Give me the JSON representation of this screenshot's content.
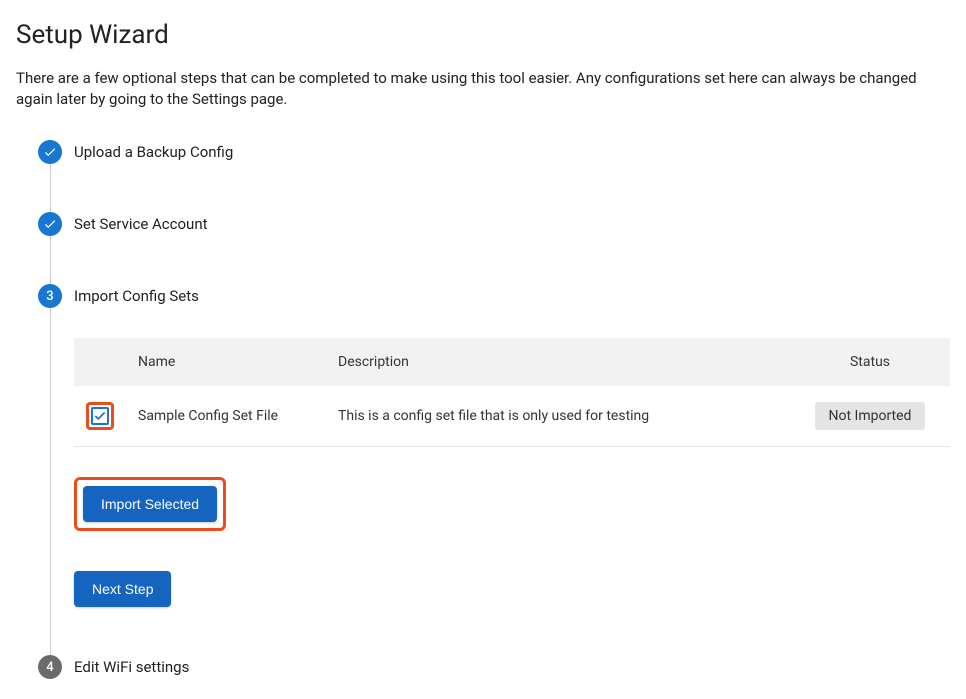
{
  "page": {
    "title": "Setup Wizard",
    "description": "There are a few optional steps that can be completed to make using this tool easier. Any configurations set here can always be changed again later by going to the Settings page."
  },
  "steps": {
    "0": {
      "title": "Upload a Backup Config",
      "state": "done"
    },
    "1": {
      "title": "Set Service Account",
      "state": "done"
    },
    "2": {
      "title": "Import Config Sets",
      "state": "active",
      "number": "3"
    },
    "3": {
      "title": "Edit WiFi settings",
      "state": "pending",
      "number": "4"
    }
  },
  "configTable": {
    "headers": {
      "name": "Name",
      "description": "Description",
      "status": "Status"
    },
    "rows": {
      "0": {
        "name": "Sample Config Set File",
        "description": "This is a config set file that is only used for testing",
        "status": "Not Imported",
        "checked": true
      }
    }
  },
  "buttons": {
    "importSelected": "Import Selected",
    "nextStep": "Next Step"
  }
}
